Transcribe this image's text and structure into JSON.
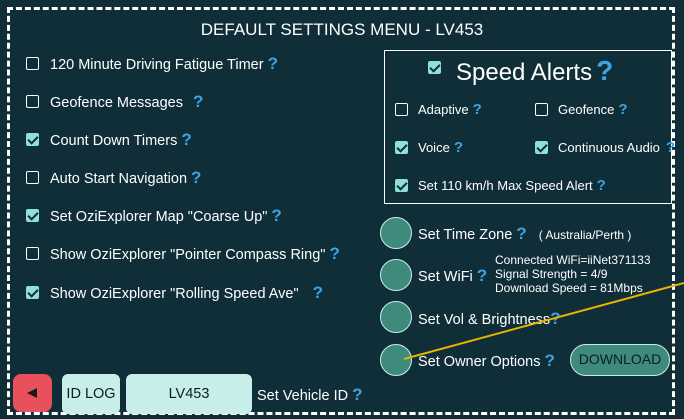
{
  "title": "DEFAULT SETTINGS MENU - LV453",
  "help_mark": "?",
  "options": [
    {
      "label": "120 Minute Driving Fatigue Timer",
      "checked": false
    },
    {
      "label": "Geofence Messages",
      "checked": false
    },
    {
      "label": "Count Down Timers",
      "checked": true
    },
    {
      "label": "Auto Start Navigation",
      "checked": false
    },
    {
      "label": "Set OziExplorer Map \"Coarse Up\"",
      "checked": true
    },
    {
      "label": "Show OziExplorer \"Pointer Compass Ring\"",
      "checked": false
    },
    {
      "label": "Show OziExplorer \"Rolling Speed Ave\"",
      "checked": true
    }
  ],
  "speed_alerts": {
    "title": "Speed Alerts",
    "checked": true,
    "adaptive": {
      "label": "Adaptive",
      "checked": false
    },
    "geofence": {
      "label": "Geofence",
      "checked": false
    },
    "voice": {
      "label": "Voice",
      "checked": true
    },
    "continuous_audio": {
      "label": "Continuous Audio",
      "checked": true
    },
    "max_speed": {
      "label": "Set 110 km/h Max Speed Alert",
      "checked": true
    }
  },
  "actions": {
    "time_zone": {
      "label": "Set Time Zone",
      "value": "( Australia/Perth )"
    },
    "wifi": {
      "label": "Set WiFi",
      "connected": "Connected WiFi=iiNet371133",
      "signal": "Signal Strength = 4/9",
      "download_speed": "Download Speed = 81Mbps"
    },
    "vol_brightness": {
      "label": "Set Vol & Brightness"
    },
    "owner_options": {
      "label": "Set Owner Options"
    },
    "download_button": "DOWNLOAD"
  },
  "bottom": {
    "back_icon": "left-triangle-icon",
    "id_log": "ID LOG",
    "vehicle_id": "LV453",
    "set_vehicle_id": "Set Vehicle ID"
  },
  "colors": {
    "background": "#0f2e38",
    "accent": "#3ba3e6",
    "teal": "#3e8a7c",
    "checkbox": "#8fe0d8",
    "back_button": "#e8505b",
    "annotation_line": "#e8b400"
  }
}
